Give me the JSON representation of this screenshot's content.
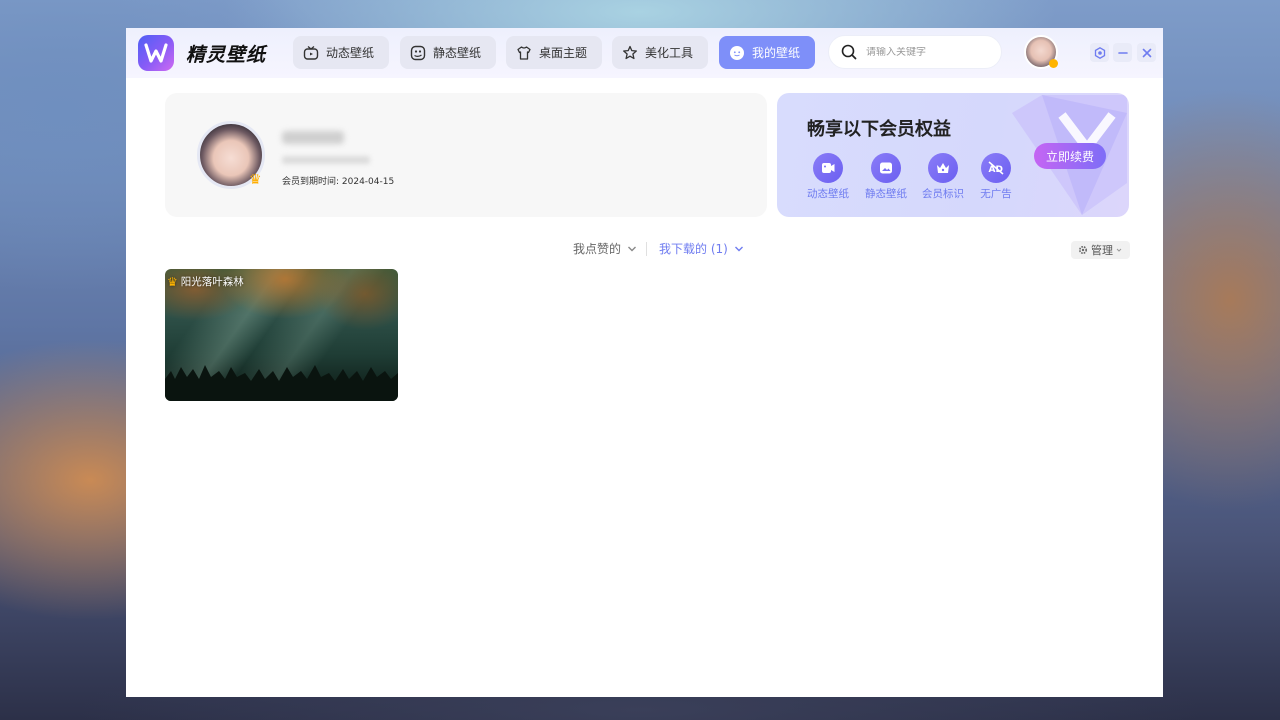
{
  "app": {
    "name": "精灵壁纸",
    "accent_color": "#7e8ff9",
    "logo_icon": "app-logo-icon"
  },
  "nav": {
    "items": [
      {
        "label": "动态壁纸",
        "icon": "tv-icon",
        "active": false
      },
      {
        "label": "静态壁纸",
        "icon": "image-icon",
        "active": false
      },
      {
        "label": "桌面主题",
        "icon": "shirt-icon",
        "active": false
      },
      {
        "label": "美化工具",
        "icon": "magic-wand-icon",
        "active": false
      },
      {
        "label": "我的壁纸",
        "icon": "smile-icon",
        "active": true
      }
    ]
  },
  "search": {
    "placeholder": "请输入关键字",
    "icon": "search-icon"
  },
  "window_controls": {
    "settings_icon": "settings-icon",
    "minimize_icon": "minimize-icon",
    "close_icon": "close-icon"
  },
  "profile": {
    "expiry_label": "会员到期时间: ",
    "expiry_date": "2024-04-15"
  },
  "vip": {
    "title": "畅享以下会员权益",
    "benefits": [
      {
        "label": "动态壁纸",
        "icon": "video-icon"
      },
      {
        "label": "静态壁纸",
        "icon": "picture-icon"
      },
      {
        "label": "会员标识",
        "icon": "crown-icon"
      },
      {
        "label": "无广告",
        "icon": "no-ad-icon"
      }
    ],
    "renew_label": "立即续费"
  },
  "filters": {
    "liked_label": "我点赞的",
    "downloaded_label": "我下载的 (1)",
    "manage_label": "管理"
  },
  "wallpapers": [
    {
      "title": "阳光落叶森林",
      "vip": true
    }
  ]
}
